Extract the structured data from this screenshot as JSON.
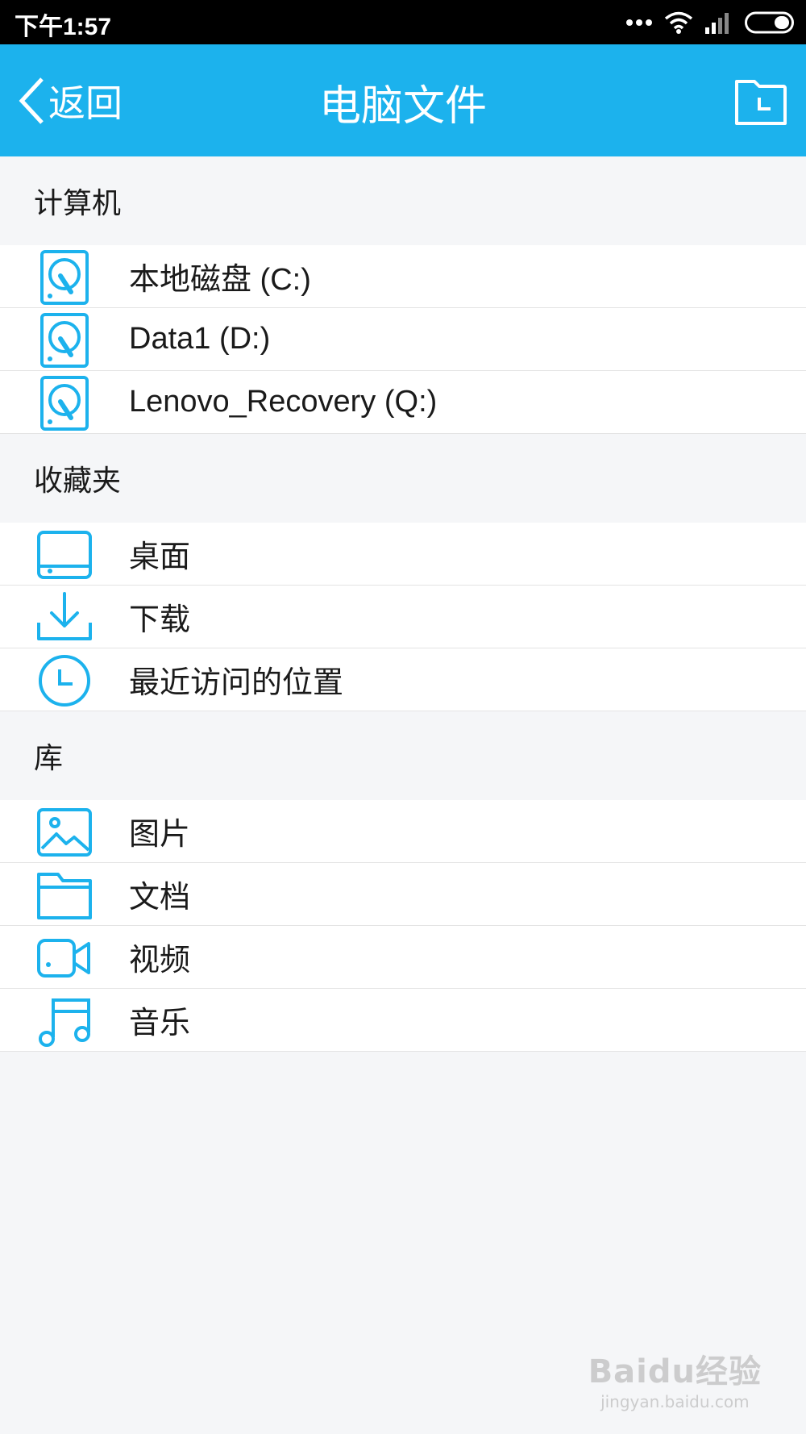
{
  "status_bar": {
    "time": "下午1:57",
    "icons": [
      "more-dots-icon",
      "wifi-icon",
      "signal-icon",
      "battery-icon"
    ]
  },
  "nav": {
    "back_label": "返回",
    "title": "电脑文件",
    "recent_icon": "recent-folder-icon"
  },
  "sections": [
    {
      "title": "计算机",
      "items": [
        {
          "label": "本地磁盘 (C:)",
          "icon": "disk-icon"
        },
        {
          "label": "Data1 (D:)",
          "icon": "disk-icon"
        },
        {
          "label": "Lenovo_Recovery (Q:)",
          "icon": "disk-icon"
        }
      ]
    },
    {
      "title": "收藏夹",
      "items": [
        {
          "label": "桌面",
          "icon": "desktop-icon"
        },
        {
          "label": "下载",
          "icon": "download-icon"
        },
        {
          "label": "最近访问的位置",
          "icon": "clock-icon"
        }
      ]
    },
    {
      "title": "库",
      "items": [
        {
          "label": "图片",
          "icon": "picture-icon"
        },
        {
          "label": "文档",
          "icon": "folder-icon"
        },
        {
          "label": "视频",
          "icon": "video-icon"
        },
        {
          "label": "音乐",
          "icon": "music-icon"
        }
      ]
    }
  ],
  "watermark": {
    "brand": "Baidu经验",
    "url": "jingyan.baidu.com"
  },
  "colors": {
    "accent": "#1cb2ed",
    "background": "#f5f6f8",
    "icon": "#1cb2ed"
  }
}
